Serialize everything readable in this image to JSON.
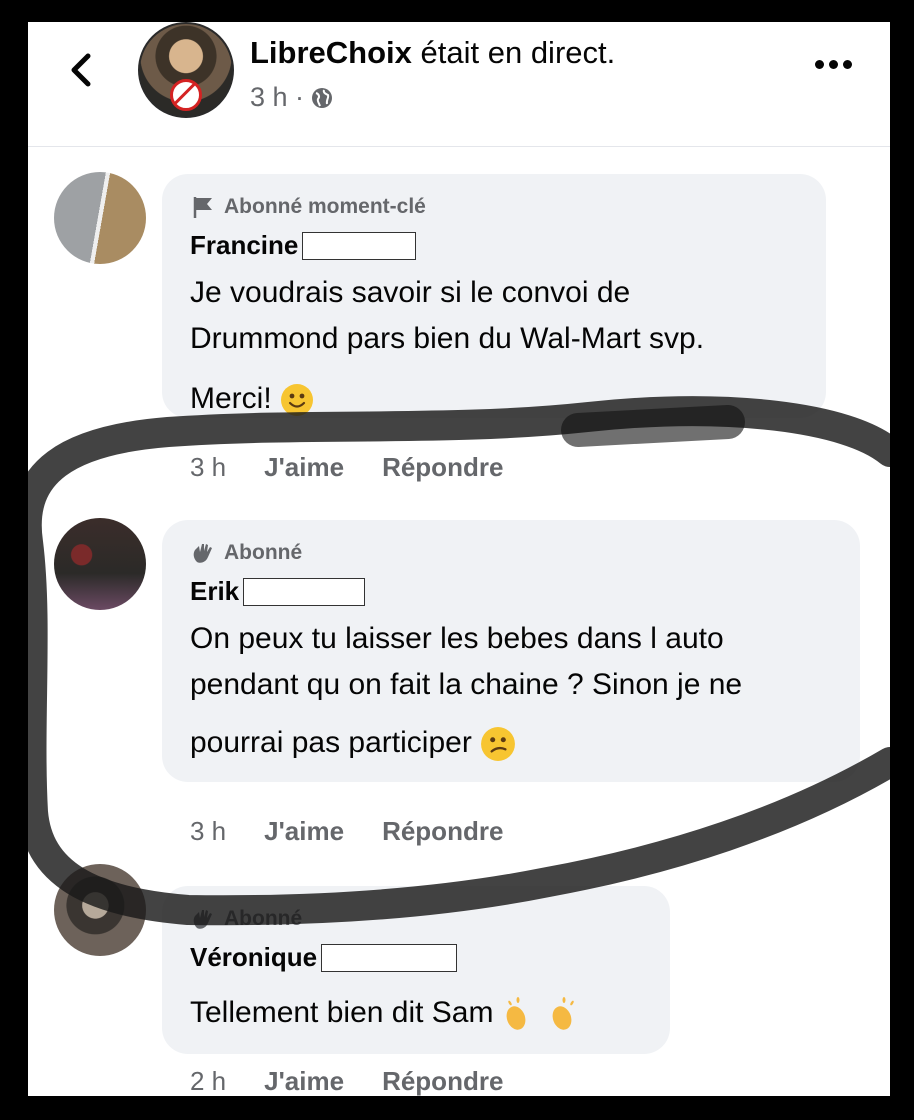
{
  "header": {
    "page_name": "LibreChoix",
    "action": " était en direct.",
    "time": "3 h ·"
  },
  "comments": [
    {
      "badge": "Abonné moment-clé",
      "author": "Francine",
      "lines": [
        "Je voudrais savoir si le convoi de",
        "Drummond pars bien du Wal-Mart svp."
      ],
      "line3": "Merci!",
      "time": "3 h",
      "like": "J'aime",
      "reply": "Répondre"
    },
    {
      "badge": "Abonné",
      "author": "Erik",
      "lines": [
        "On peux tu laisser les bebes dans l auto",
        "pendant qu on fait la chaine ? Sinon je ne"
      ],
      "line3": "pourrai pas participer",
      "time": "3 h",
      "like": "J'aime",
      "reply": "Répondre"
    },
    {
      "badge": "Abonné",
      "author": "Véronique",
      "lines": [
        "Tellement bien dit Sam"
      ],
      "time": "2 h",
      "like": "J'aime",
      "reply": "Répondre"
    }
  ],
  "icons": {
    "back": "chevron-left-icon",
    "privacy": "globe-icon",
    "more": "more-horizontal-icon",
    "badge_top_fan": "flag-icon",
    "badge_follower": "waving-hand-icon"
  },
  "colors": {
    "bubble": "#f0f2f5",
    "secondary_text": "#65676b",
    "marker": "#1a1a1a"
  }
}
